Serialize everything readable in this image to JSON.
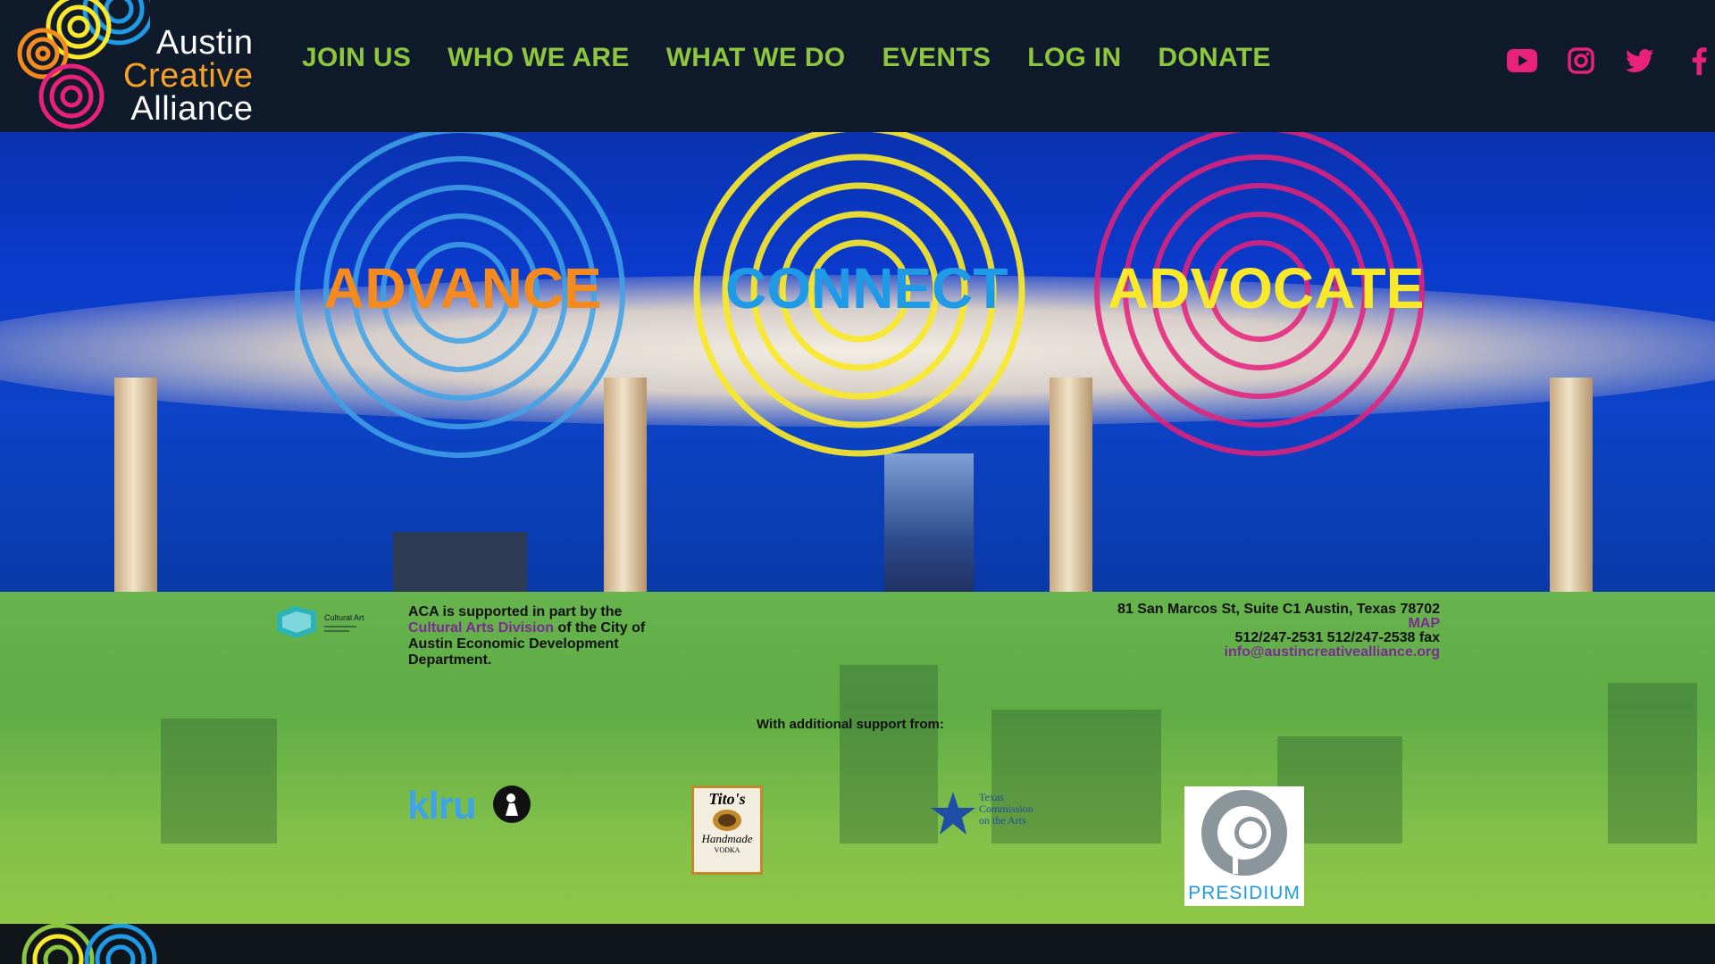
{
  "brand": {
    "line1": "Austin",
    "line2": "Creative",
    "line3": "Alliance"
  },
  "nav": {
    "items": [
      "JOIN US",
      "WHO WE ARE",
      "WHAT WE DO",
      "EVENTS",
      "LOG IN",
      "DONATE"
    ]
  },
  "social": [
    "youtube-icon",
    "instagram-icon",
    "twitter-icon",
    "facebook-icon"
  ],
  "hero": {
    "words": [
      "ADVANCE",
      "CONNECT",
      "ADVOCATE"
    ]
  },
  "footer": {
    "cultural_arts_logo": "Cultural Arts",
    "support_pre": "ACA is supported in part by the",
    "support_link": "Cultural Arts Division",
    "support_post": "of the City of Austin Economic Development Department.",
    "address": "81 San Marcos St, Suite C1 Austin, Texas 78702",
    "map": "MAP",
    "phones": "512/247-2531 512/247-2538 fax",
    "email": "info@austincreativealliance.org",
    "additional": "With additional support from:",
    "sponsors": {
      "klru": "klru",
      "titos_top": "Tito's",
      "titos_mid": "Handmade",
      "titos_bot": "VODKA",
      "texas_l1": "Texas",
      "texas_l2": "Commission",
      "texas_l3": "on the Arts",
      "presidium": "PRESIDIUM"
    }
  },
  "colors": {
    "nav_green": "#8dc63f",
    "social_pink": "#e8217a",
    "orange": "#f58a1f",
    "blue": "#1f9ae6",
    "yellow": "#f9e92a",
    "purple_link": "#7b2b93"
  }
}
